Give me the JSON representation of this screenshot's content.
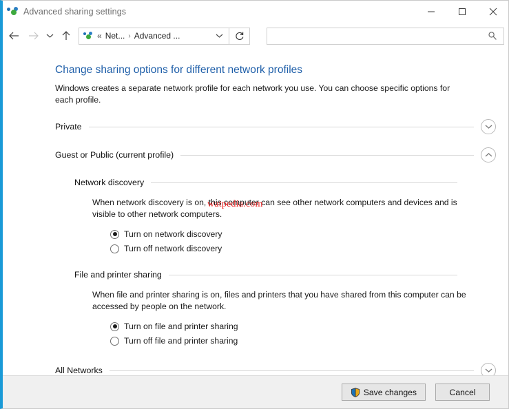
{
  "window": {
    "title": "Advanced sharing settings",
    "app_icon": "network-icon",
    "controls": {
      "minimize": "minimize-button",
      "maximize": "maximize-button",
      "close": "close-button"
    },
    "accent_color": "#1a9ad7"
  },
  "nav": {
    "back": "back-arrow",
    "forward": "forward-arrow",
    "recent": "recent-locations-chevron",
    "up": "up-arrow",
    "refresh": "refresh-icon",
    "breadcrumb": {
      "icon": "network-icon",
      "overflow": "«",
      "items": [
        "Net...",
        "Advanced ..."
      ],
      "separator": "›",
      "caret": "chevron-down-icon"
    },
    "search": {
      "value": "",
      "placeholder": "",
      "icon": "search-icon"
    }
  },
  "main": {
    "heading": "Change sharing options for different network profiles",
    "description": "Windows creates a separate network profile for each network you use. You can choose specific options for each profile.",
    "watermark": "watpedia.com",
    "sections": [
      {
        "title": "Private",
        "expanded": false,
        "toggle_icon": "chevron-down-icon"
      },
      {
        "title": "Guest or Public (current profile)",
        "expanded": true,
        "toggle_icon": "chevron-up-icon"
      },
      {
        "title": "All Networks",
        "expanded": false,
        "toggle_icon": "chevron-down-icon"
      }
    ],
    "subsections": [
      {
        "title": "Network discovery",
        "description": "When network discovery is on, this computer can see other network computers and devices and is visible to other network computers.",
        "options": [
          {
            "label": "Turn on network discovery",
            "selected": true
          },
          {
            "label": "Turn off network discovery",
            "selected": false
          }
        ]
      },
      {
        "title": "File and printer sharing",
        "description": "When file and printer sharing is on, files and printers that you have shared from this computer can be accessed by people on the network.",
        "options": [
          {
            "label": "Turn on file and printer sharing",
            "selected": true
          },
          {
            "label": "Turn off file and printer sharing",
            "selected": false
          }
        ]
      }
    ]
  },
  "footer": {
    "save_label": "Save changes",
    "save_icon": "uac-shield-icon",
    "cancel_label": "Cancel"
  }
}
